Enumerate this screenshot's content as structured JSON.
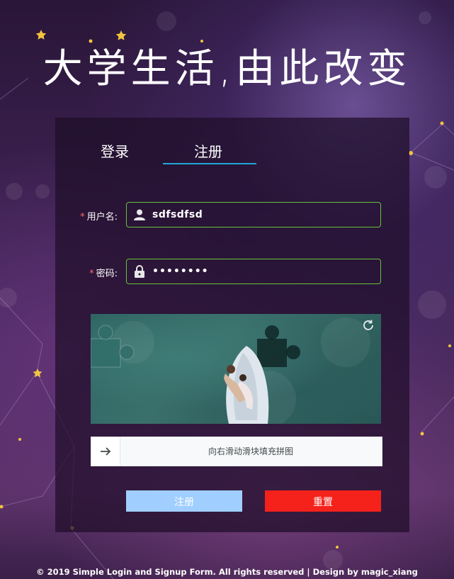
{
  "header": {
    "title": "大学生活,由此改变"
  },
  "tabs": {
    "login": "登录",
    "register": "注册"
  },
  "form": {
    "username": {
      "label": "用户名:",
      "required_mark": "*",
      "value": "sdfsdfsd"
    },
    "password": {
      "label": "密码:",
      "required_mark": "*",
      "value": "••••••••"
    }
  },
  "captcha": {
    "slider_hint": "向右滑动滑块填充拼图"
  },
  "buttons": {
    "register": "注册",
    "reset": "重置"
  },
  "footer": {
    "text": "© 2019 Simple Login and Signup Form. All rights reserved | Design by magic_xiang"
  },
  "colors": {
    "tab_underline": "#1fa6d8",
    "field_border": "#67c23a",
    "register_button": "#a0cfff",
    "reset_button": "#f5221b",
    "required_mark": "#f56c6c"
  },
  "icons": [
    "user-icon",
    "lock-icon",
    "refresh-icon",
    "arrow-right-icon",
    "star-icon"
  ]
}
